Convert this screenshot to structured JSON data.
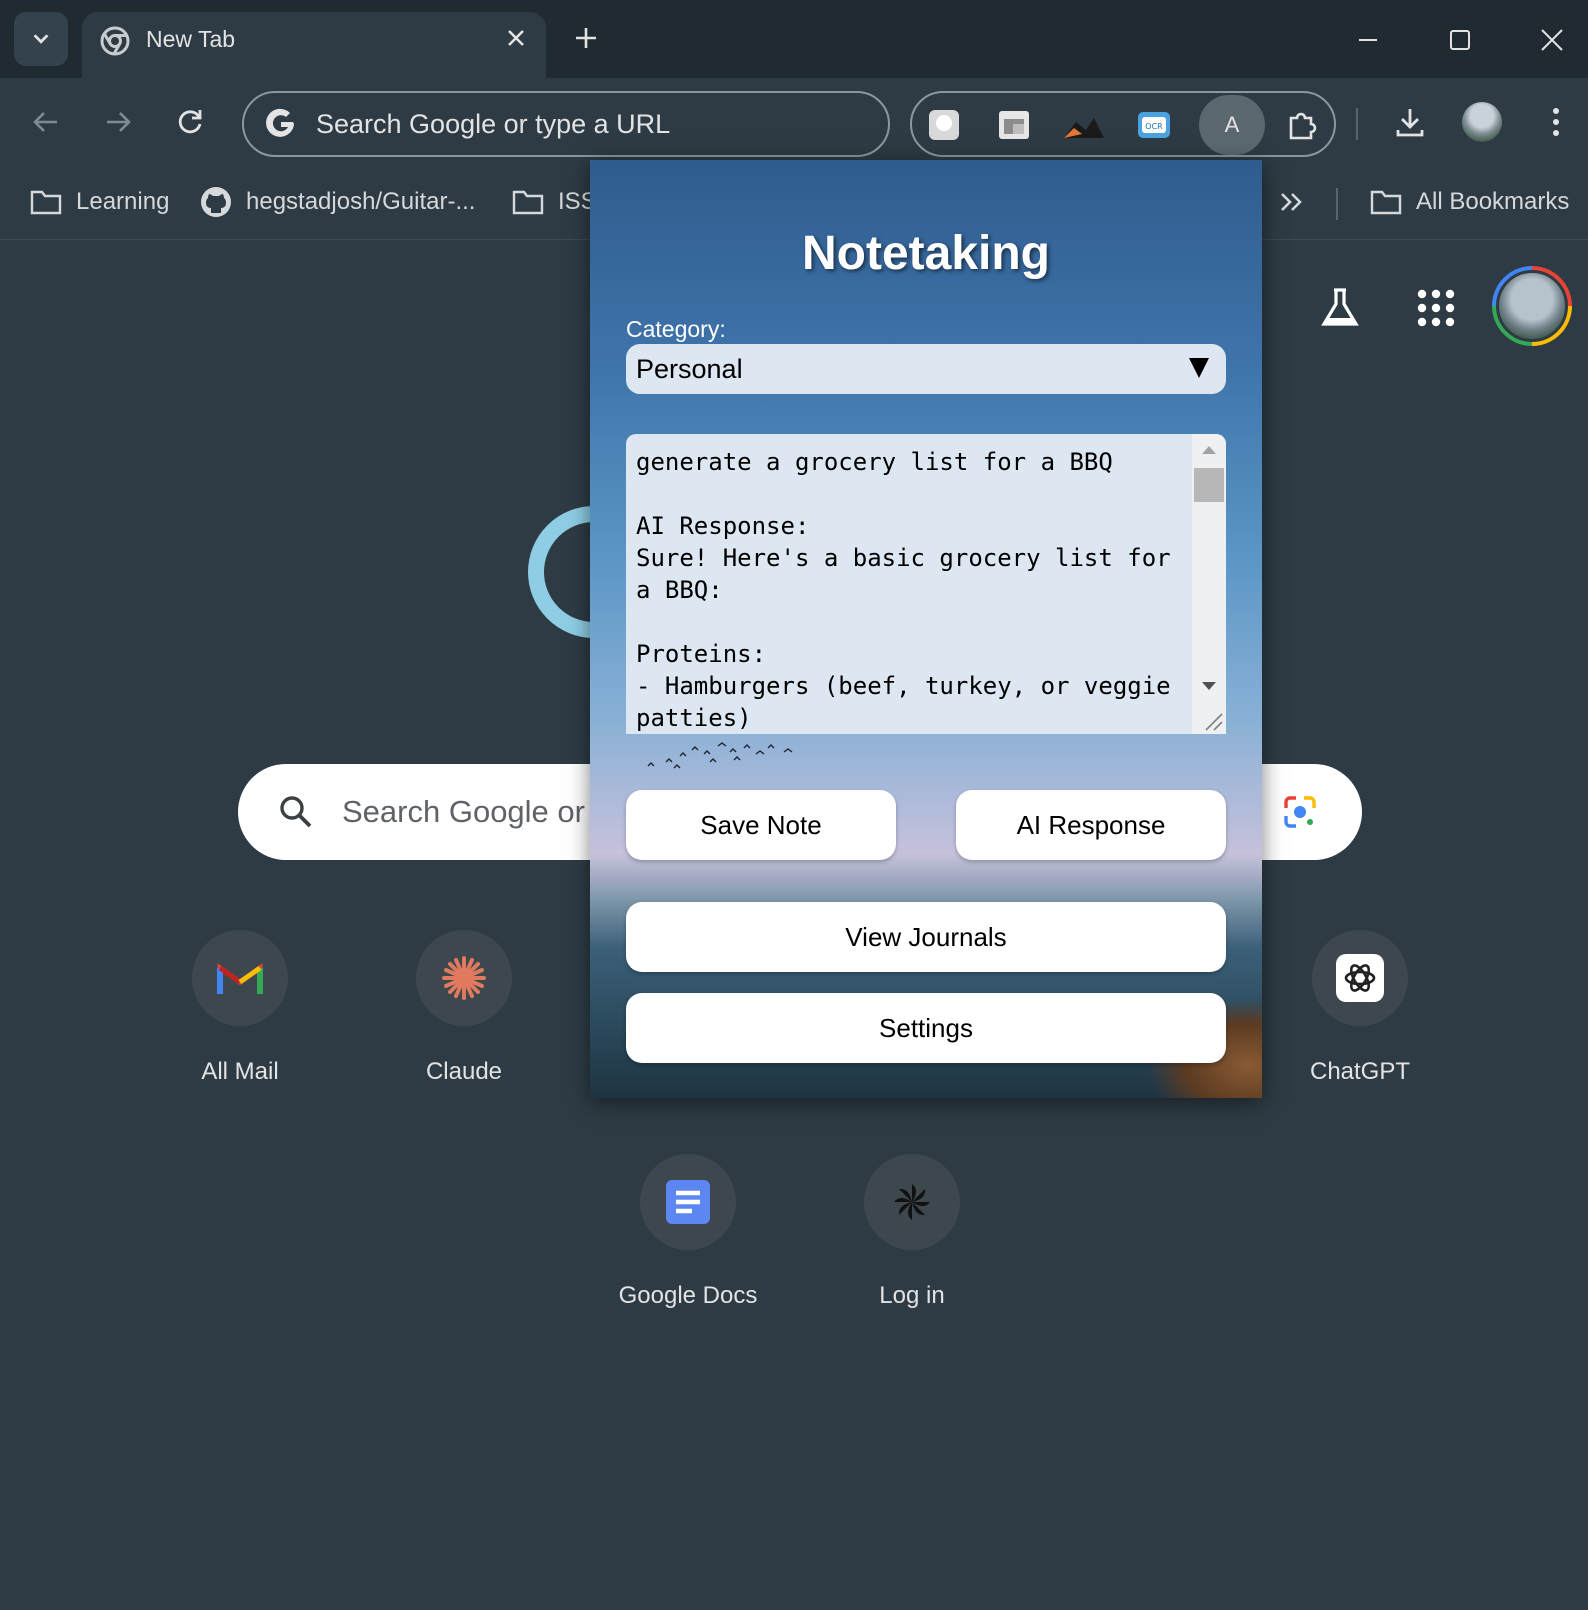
{
  "browser": {
    "tab_title": "New Tab",
    "omnibox_placeholder": "Search Google or type a URL",
    "profile_extension_letter": "A"
  },
  "bookmarks": [
    {
      "label": "Learning",
      "icon": "folder-icon"
    },
    {
      "label": "hegstadjosh/Guitar-...",
      "icon": "github-icon"
    },
    {
      "label": "ISS",
      "icon": "folder-icon"
    },
    {
      "label": "All Bookmarks",
      "icon": "folder-icon"
    }
  ],
  "ntp": {
    "search_placeholder": "Search Google or",
    "shortcuts": [
      {
        "label": "All Mail",
        "icon": "gmail-icon"
      },
      {
        "label": "Claude",
        "icon": "claude-icon"
      },
      {
        "label": "ChatGPT",
        "icon": "chatgpt-icon"
      },
      {
        "label": "Google Docs",
        "icon": "google-docs-icon"
      },
      {
        "label": "Log in",
        "icon": "login-icon"
      }
    ]
  },
  "popup": {
    "title": "Notetaking",
    "category_label": "Category:",
    "category_value": "Personal",
    "note_text": "generate a grocery list for a BBQ\n\nAI Response:\nSure! Here's a basic grocery list for a BBQ:\n\nProteins:\n- Hamburgers (beef, turkey, or veggie patties)",
    "save_label": "Save Note",
    "ai_label": "AI Response",
    "journals_label": "View Journals",
    "settings_label": "Settings"
  },
  "colors": {
    "page_bg": "#2e3b44",
    "titlebar_bg": "#1f2a31",
    "popup_top": "#2f5c8e",
    "button_bg": "#ffffff"
  }
}
